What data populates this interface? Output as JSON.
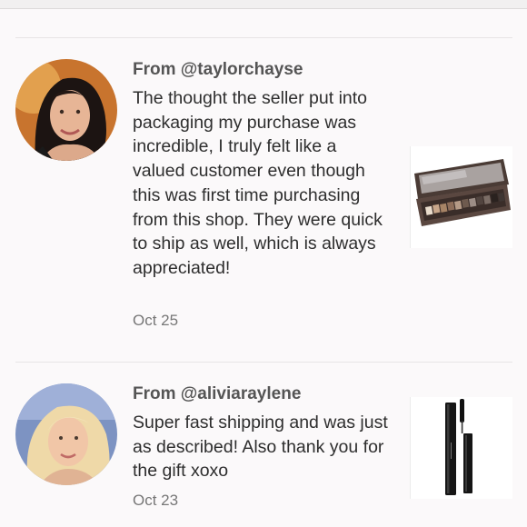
{
  "reviews": [
    {
      "author": "From @taylorchayse",
      "text": "The thought the seller put into packaging my purchase was incredible, I truly felt like a valued customer even though this was first time purchasing from this shop. They were quick to ship as well, which is always appreciated!",
      "date": "Oct 25",
      "avatar_icon": "avatar-photo-icon",
      "product_icon": "eyeshadow-palette-icon"
    },
    {
      "author": "From @aliviaraylene",
      "text": "Super fast shipping and was just as described! Also thank you for the gift xoxo",
      "date": "Oct 23",
      "avatar_icon": "avatar-photo-icon",
      "product_icon": "mascara-icon"
    }
  ],
  "colors": {
    "background": "#fbf9fa",
    "author_text": "#555555",
    "body_text": "#2e2e2e",
    "date_text": "#777777",
    "divider": "#e7e4e5"
  }
}
